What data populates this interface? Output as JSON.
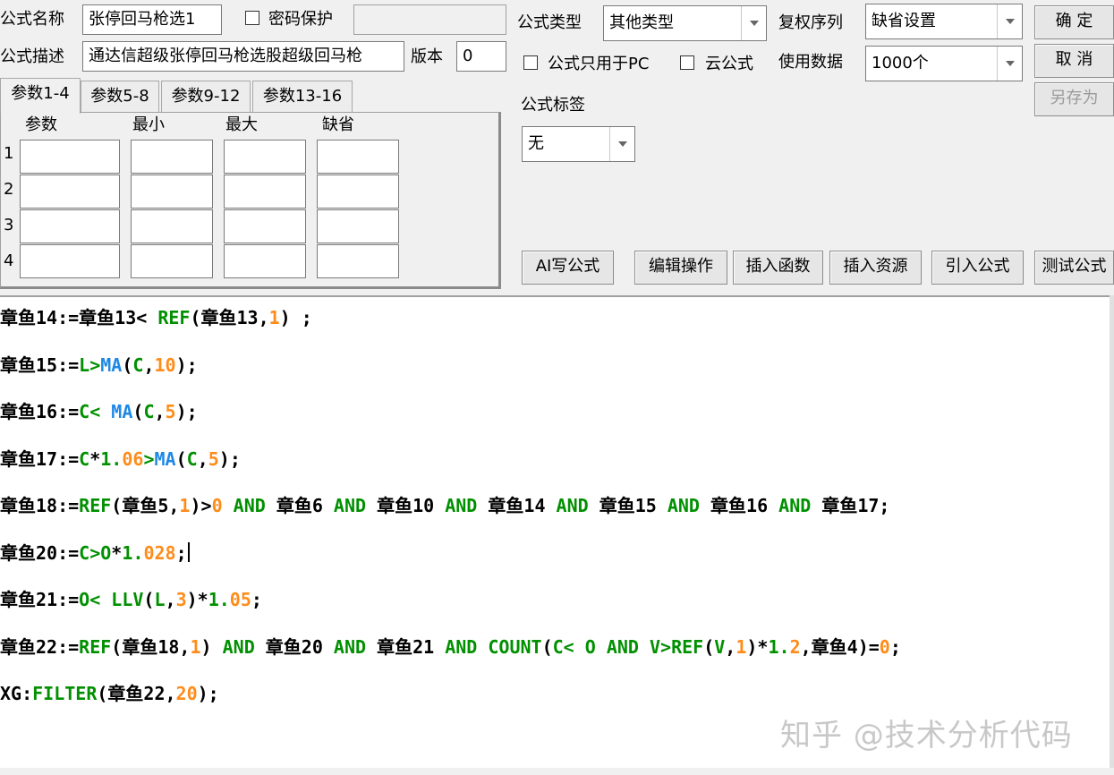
{
  "form": {
    "name_label": "公式名称",
    "name_value": "张停回马枪选1",
    "password_label": "密码保护",
    "desc_label": "公式描述",
    "desc_value": "通达信超级张停回马枪选股超级回马枪",
    "version_label": "版本",
    "version_value": "0",
    "type_label": "公式类型",
    "type_value": "其他类型",
    "fuquan_label": "复权序列",
    "fuquan_value": "缺省设置",
    "pc_only_label": "公式只用于PC",
    "cloud_label": "云公式",
    "data_label": "使用数据",
    "data_value": "1000个",
    "tag_label": "公式标签",
    "tag_value": "无"
  },
  "buttons": {
    "ok": "确 定",
    "cancel": "取 消",
    "save_as": "另存为",
    "ai": "AI写公式",
    "edit": "编辑操作",
    "insert_func": "插入函数",
    "insert_res": "插入资源",
    "import": "引入公式",
    "test": "测试公式"
  },
  "tabs": [
    "参数1-4",
    "参数5-8",
    "参数9-12",
    "参数13-16"
  ],
  "params": {
    "headers": [
      "参数",
      "最小",
      "最大",
      "缺省"
    ],
    "rows": [
      "1",
      "2",
      "3",
      "4"
    ]
  },
  "code_lines": [
    [
      [
        "章鱼14:=章鱼13< ",
        "k"
      ],
      [
        "REF",
        "g"
      ],
      [
        "(章鱼13,",
        "k"
      ],
      [
        "1",
        "o"
      ],
      [
        ") ;",
        "k"
      ]
    ],
    [
      [
        "章鱼15:=",
        "k"
      ],
      [
        "L>",
        "g"
      ],
      [
        "MA",
        "b"
      ],
      [
        "(",
        "k"
      ],
      [
        "C",
        "g"
      ],
      [
        ",",
        "k"
      ],
      [
        "10",
        "o"
      ],
      [
        ");",
        "k"
      ]
    ],
    [
      [
        "章鱼16:=",
        "k"
      ],
      [
        "C< ",
        "g"
      ],
      [
        "MA",
        "b"
      ],
      [
        "(",
        "k"
      ],
      [
        "C",
        "g"
      ],
      [
        ",",
        "k"
      ],
      [
        "5",
        "o"
      ],
      [
        ");",
        "k"
      ]
    ],
    [
      [
        "章鱼17:=",
        "k"
      ],
      [
        "C",
        "g"
      ],
      [
        "*",
        "k"
      ],
      [
        "1.",
        "g"
      ],
      [
        "06",
        "o"
      ],
      [
        ">",
        "g"
      ],
      [
        "MA",
        "b"
      ],
      [
        "(",
        "k"
      ],
      [
        "C",
        "g"
      ],
      [
        ",",
        "k"
      ],
      [
        "5",
        "o"
      ],
      [
        ");",
        "k"
      ]
    ],
    [
      [
        "章鱼18:=",
        "k"
      ],
      [
        "REF",
        "g"
      ],
      [
        "(章鱼5,",
        "k"
      ],
      [
        "1",
        "o"
      ],
      [
        ")>",
        "k"
      ],
      [
        "0",
        "o"
      ],
      [
        " AND ",
        "g"
      ],
      [
        "章鱼6",
        "k"
      ],
      [
        " AND ",
        "g"
      ],
      [
        "章鱼10",
        "k"
      ],
      [
        " AND ",
        "g"
      ],
      [
        "章鱼14",
        "k"
      ],
      [
        " AND ",
        "g"
      ],
      [
        "章鱼15",
        "k"
      ],
      [
        " AND ",
        "g"
      ],
      [
        "章鱼16",
        "k"
      ],
      [
        " AND ",
        "g"
      ],
      [
        "章鱼17;",
        "k"
      ]
    ],
    [
      [
        "章鱼20:=",
        "k"
      ],
      [
        "C>O",
        "g"
      ],
      [
        "*",
        "k"
      ],
      [
        "1.",
        "g"
      ],
      [
        "028",
        "o"
      ],
      [
        ";",
        "k"
      ]
    ],
    [
      [
        "章鱼21:=",
        "k"
      ],
      [
        "O< LLV",
        "g"
      ],
      [
        "(",
        "k"
      ],
      [
        "L",
        "g"
      ],
      [
        ",",
        "k"
      ],
      [
        "3",
        "o"
      ],
      [
        ")*",
        "k"
      ],
      [
        "1.",
        "g"
      ],
      [
        "05",
        "o"
      ],
      [
        ";",
        "k"
      ]
    ],
    [
      [
        "章鱼22:=",
        "k"
      ],
      [
        "REF",
        "g"
      ],
      [
        "(章鱼18,",
        "k"
      ],
      [
        "1",
        "o"
      ],
      [
        ") ",
        "k"
      ],
      [
        "AND ",
        "g"
      ],
      [
        "章鱼20 ",
        "k"
      ],
      [
        "AND ",
        "g"
      ],
      [
        "章鱼21 ",
        "k"
      ],
      [
        "AND COUNT",
        "g"
      ],
      [
        "(",
        "k"
      ],
      [
        "C< O AND V>REF",
        "g"
      ],
      [
        "(",
        "k"
      ],
      [
        "V",
        "g"
      ],
      [
        ",",
        "k"
      ],
      [
        "1",
        "o"
      ],
      [
        ")*",
        "k"
      ],
      [
        "1.",
        "g"
      ],
      [
        "2",
        "o"
      ],
      [
        ",章鱼4)=",
        "k"
      ],
      [
        "0",
        "o"
      ],
      [
        ";",
        "k"
      ]
    ],
    [
      [
        "XG:",
        "k"
      ],
      [
        "FILTER",
        "g"
      ],
      [
        "(章鱼22,",
        "k"
      ],
      [
        "20",
        "o"
      ],
      [
        ");",
        "k"
      ]
    ]
  ],
  "colors": {
    "green": "#009000",
    "blue": "#1e88e5",
    "orange": "#ff8c1a"
  },
  "watermark": "知乎 @技术分析代码"
}
